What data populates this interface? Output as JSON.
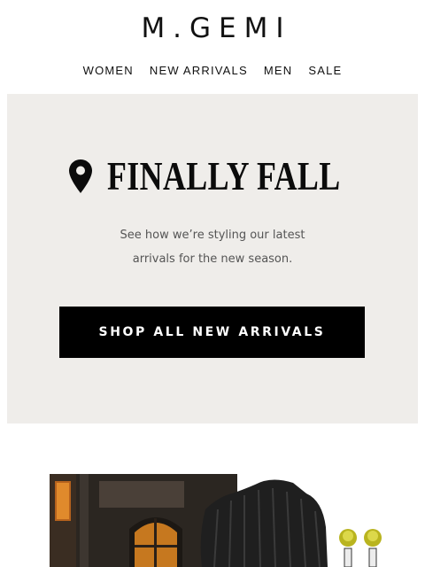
{
  "header": {
    "logo": "M.GEMI"
  },
  "nav": {
    "items": [
      "WOMEN",
      "NEW ARRIVALS",
      "MEN",
      "SALE"
    ]
  },
  "hero": {
    "headline": "FINALLY FALL",
    "subtext_line1": "See how we’re styling our latest",
    "subtext_line2": "arrivals for the new season.",
    "cta_label": "SHOP ALL NEW ARRIVALS",
    "pin_icon": "location-pin-icon"
  },
  "colors": {
    "hero_bg": "#efedea",
    "cta_bg": "#000000",
    "text": "#111111"
  }
}
